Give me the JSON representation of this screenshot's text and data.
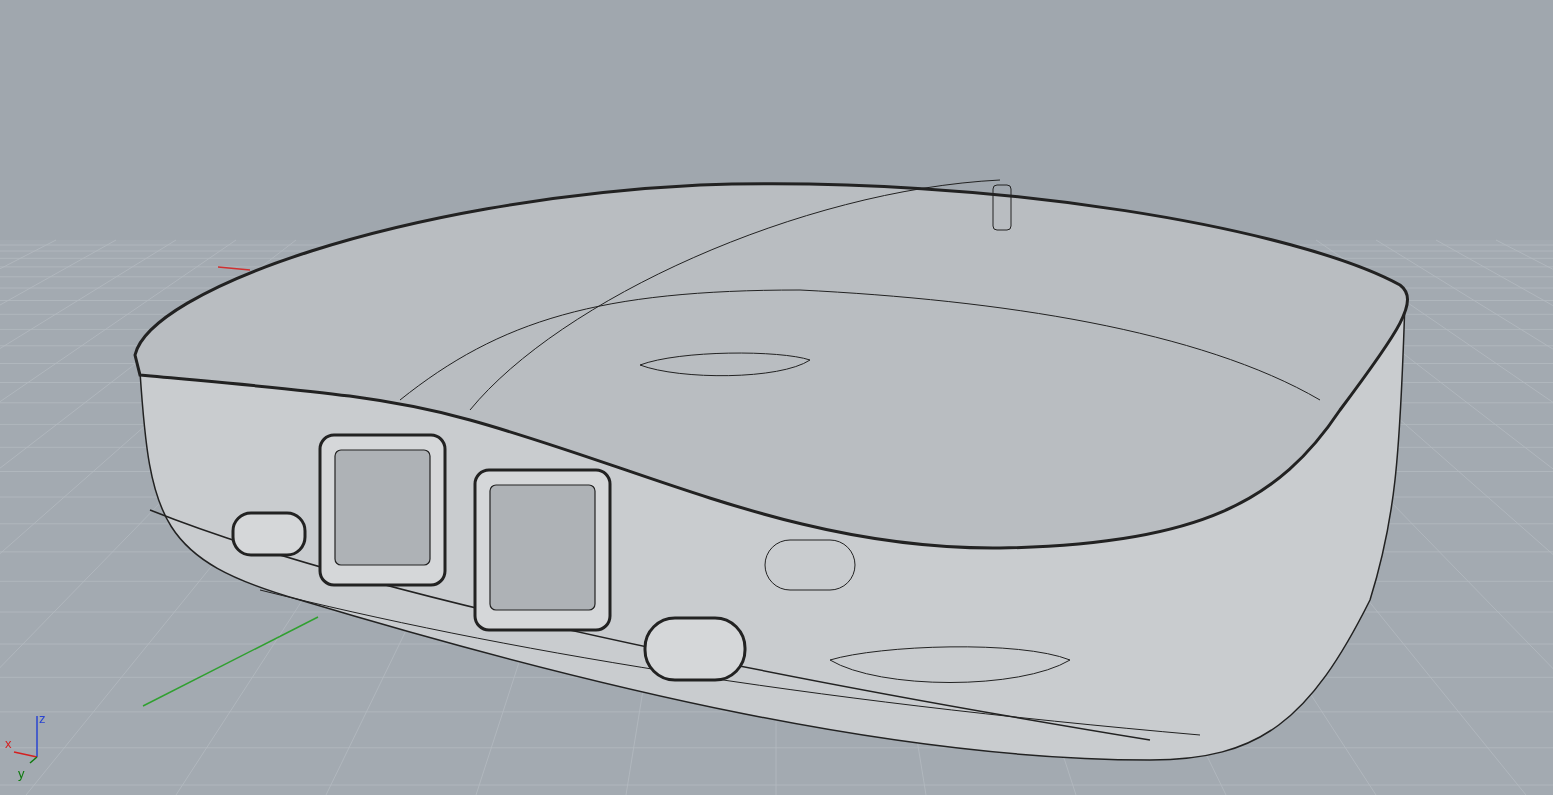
{
  "viewport": {
    "axes": [
      {
        "kind": "z",
        "label": "z",
        "color": "#2a44d0"
      },
      {
        "kind": "x",
        "label": "x",
        "color": "#d42020"
      },
      {
        "kind": "y",
        "label": "y",
        "color": "#0e7a0e"
      }
    ]
  }
}
